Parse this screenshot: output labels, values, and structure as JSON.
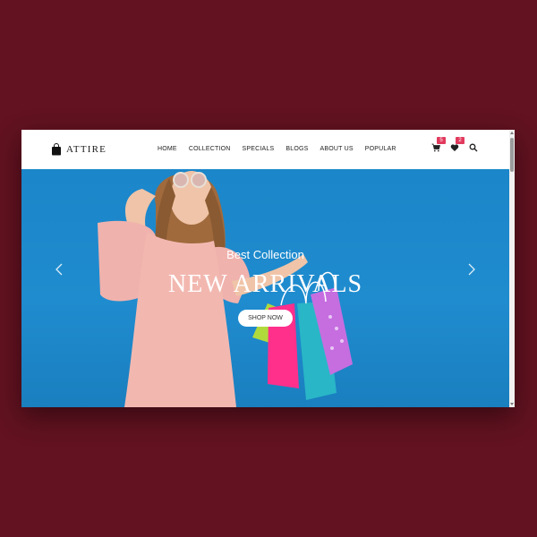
{
  "brand": {
    "name": "ATTIRE",
    "logo_icon": "shopping-bag-icon"
  },
  "nav": {
    "items": [
      "HOME",
      "COLLECTION",
      "SPECIALS",
      "BLOGS",
      "ABOUT US",
      "POPULAR"
    ]
  },
  "header_icons": {
    "cart": {
      "icon": "cart-icon",
      "count": "5"
    },
    "wishlist": {
      "icon": "heart-icon",
      "count": "2"
    },
    "search": {
      "icon": "search-icon"
    }
  },
  "hero": {
    "subtitle": "Best Collection",
    "title": "NEW ARRIVALS",
    "button_label": "SHOP NOW"
  },
  "colors": {
    "background": "#621220",
    "hero_blue": "#1f8ccf",
    "badge": "#e23a5e",
    "dress": "#f2b8b0"
  }
}
